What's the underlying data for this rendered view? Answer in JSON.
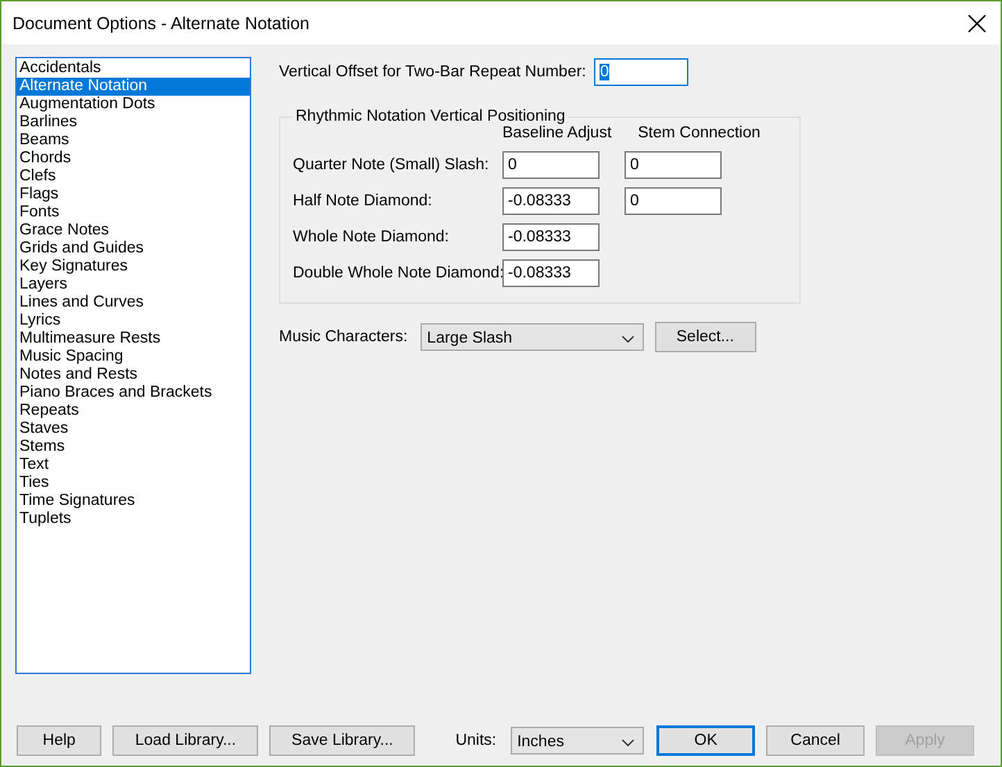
{
  "window": {
    "title": "Document Options - Alternate Notation"
  },
  "categories": [
    {
      "label": "Accidentals",
      "selected": false
    },
    {
      "label": "Alternate Notation",
      "selected": true
    },
    {
      "label": "Augmentation Dots",
      "selected": false
    },
    {
      "label": "Barlines",
      "selected": false
    },
    {
      "label": "Beams",
      "selected": false
    },
    {
      "label": "Chords",
      "selected": false
    },
    {
      "label": "Clefs",
      "selected": false
    },
    {
      "label": "Flags",
      "selected": false
    },
    {
      "label": "Fonts",
      "selected": false
    },
    {
      "label": "Grace Notes",
      "selected": false
    },
    {
      "label": "Grids and Guides",
      "selected": false
    },
    {
      "label": "Key Signatures",
      "selected": false
    },
    {
      "label": "Layers",
      "selected": false
    },
    {
      "label": "Lines and Curves",
      "selected": false
    },
    {
      "label": "Lyrics",
      "selected": false
    },
    {
      "label": "Multimeasure Rests",
      "selected": false
    },
    {
      "label": "Music Spacing",
      "selected": false
    },
    {
      "label": "Notes and Rests",
      "selected": false
    },
    {
      "label": "Piano Braces and Brackets",
      "selected": false
    },
    {
      "label": "Repeats",
      "selected": false
    },
    {
      "label": "Staves",
      "selected": false
    },
    {
      "label": "Stems",
      "selected": false
    },
    {
      "label": "Text",
      "selected": false
    },
    {
      "label": "Ties",
      "selected": false
    },
    {
      "label": "Time Signatures",
      "selected": false
    },
    {
      "label": "Tuplets",
      "selected": false
    }
  ],
  "repeat_offset": {
    "label": "Vertical Offset for Two-Bar Repeat Number:",
    "value": "0",
    "focused": true
  },
  "group": {
    "title": "Rhythmic Notation Vertical Positioning",
    "columns": [
      "Baseline Adjust",
      "Stem Connection"
    ],
    "rows": [
      {
        "label": "Quarter Note (Small) Slash:",
        "baseline": "0",
        "stem": "0"
      },
      {
        "label": "Half Note Diamond:",
        "baseline": "-0.08333",
        "stem": "0"
      },
      {
        "label": "Whole Note Diamond:",
        "baseline": "-0.08333"
      },
      {
        "label": "Double Whole Note Diamond:",
        "baseline": "-0.08333"
      }
    ]
  },
  "music_characters": {
    "label": "Music Characters:",
    "value": "Large Slash",
    "button": "Select..."
  },
  "footer": {
    "left_buttons": [
      {
        "label": "Help"
      },
      {
        "label": "Load Library..."
      },
      {
        "label": "Save Library..."
      }
    ],
    "units": {
      "label": "Units:",
      "value": "Inches"
    },
    "right_buttons": [
      {
        "label": "OK",
        "default": true,
        "disabled": false
      },
      {
        "label": "Cancel",
        "default": false,
        "disabled": false
      },
      {
        "label": "Apply",
        "default": false,
        "disabled": true
      }
    ]
  }
}
